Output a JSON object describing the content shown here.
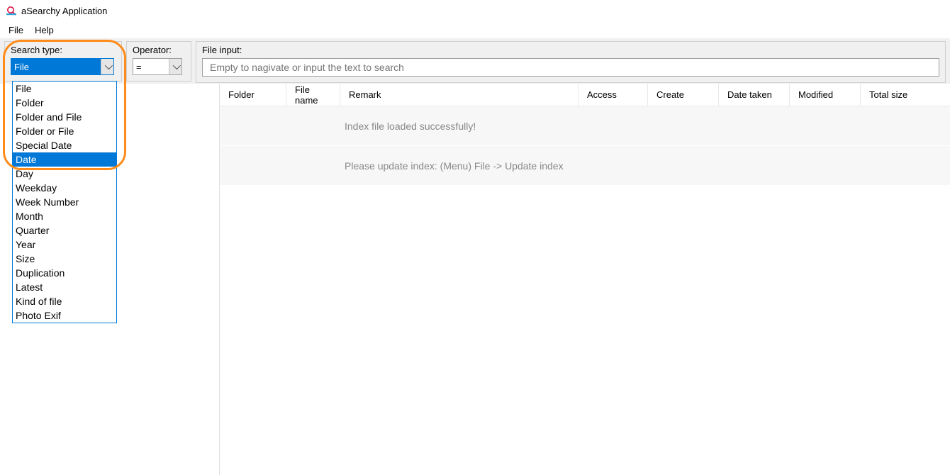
{
  "app": {
    "title": "aSearchy Application"
  },
  "menu": {
    "file": "File",
    "help": "Help"
  },
  "toolbar": {
    "search_type_label": "Search type:",
    "search_type_value": "File",
    "operator_label": "Operator:",
    "operator_value": "=",
    "file_input_label": "File input:",
    "file_input_placeholder": "Empty to nagivate or input the text to search"
  },
  "search_type_options": [
    "File",
    "Folder",
    "Folder and File",
    "Folder or File",
    "Special Date",
    "Date",
    "Day",
    "Weekday",
    "Week Number",
    "Month",
    "Quarter",
    "Year",
    "Size",
    "Duplication",
    "Latest",
    "Kind of file",
    "Photo Exif"
  ],
  "search_type_highlighted": "Date",
  "columns": {
    "folder": "Folder",
    "file_name": "File name",
    "remark": "Remark",
    "access": "Access",
    "create": "Create",
    "date_taken": "Date taken",
    "modified": "Modified",
    "total_size": "Total size"
  },
  "messages": {
    "loaded": "Index file loaded successfully!",
    "update_hint": "Please update index: (Menu) File -> Update index"
  }
}
